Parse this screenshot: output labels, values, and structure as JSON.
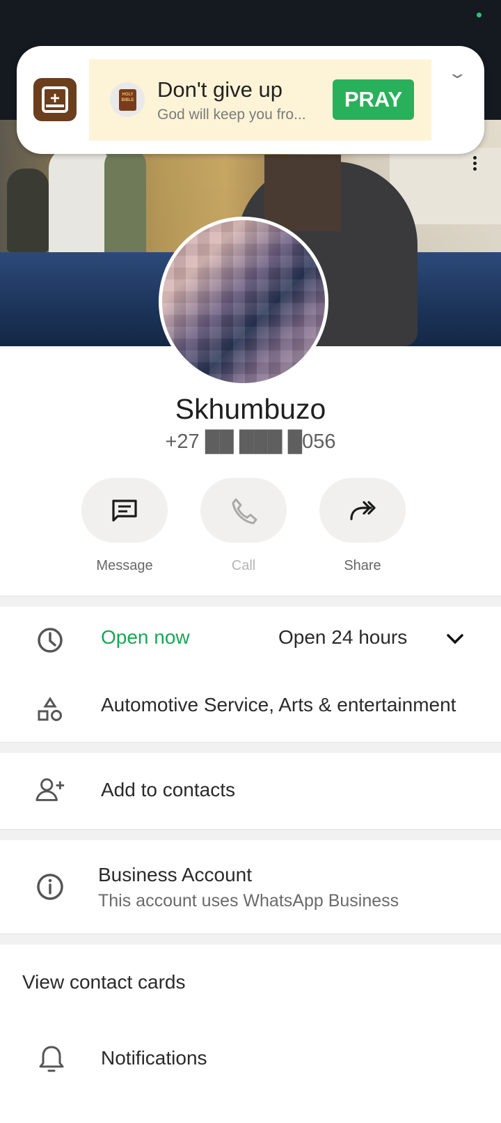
{
  "notification": {
    "ad_title": "Don't give up",
    "ad_subtitle": "God will keep you fro...",
    "ad_button": "PRAY",
    "ad_app_icon": "holy-bible-icon",
    "app_icon": "bible-app-icon"
  },
  "profile": {
    "name": "Skhumbuzo",
    "phone": "+27 ██ ███ █056"
  },
  "actions": [
    {
      "label": "Message",
      "icon": "message-icon",
      "enabled": true
    },
    {
      "label": "Call",
      "icon": "phone-icon",
      "enabled": false
    },
    {
      "label": "Share",
      "icon": "share-icon",
      "enabled": true
    }
  ],
  "business": {
    "status": "Open now",
    "hours": "Open 24 hours",
    "category": "Automotive Service, Arts & entertainment"
  },
  "add_contact": "Add to contacts",
  "business_account": {
    "title": "Business Account",
    "subtitle": "This account uses WhatsApp Business"
  },
  "view_contact_cards": "View contact cards",
  "notifications": "Notifications",
  "colors": {
    "status_bar": "#151a20",
    "accent_green": "#1aa655",
    "pray_button": "#29b05a"
  }
}
